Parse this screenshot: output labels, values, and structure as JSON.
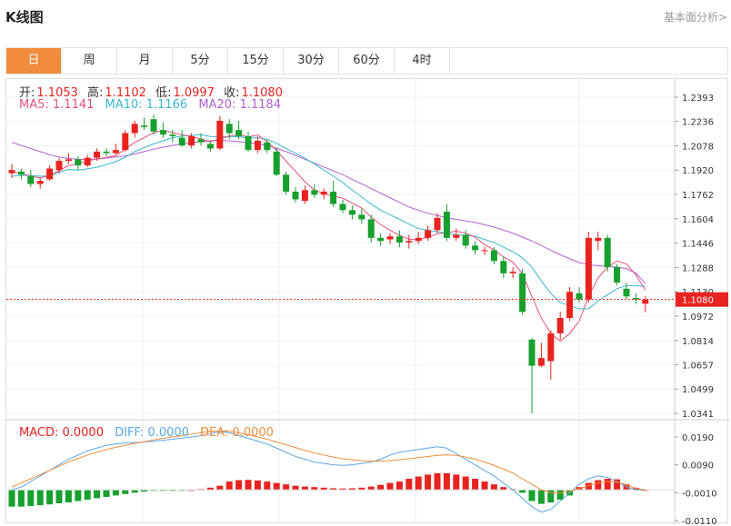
{
  "header": {
    "title": "K线图",
    "fundamental_link": "基本面分析>"
  },
  "tabs": [
    {
      "label": "日",
      "active": true
    },
    {
      "label": "周",
      "active": false
    },
    {
      "label": "月",
      "active": false
    },
    {
      "label": "5分",
      "active": false
    },
    {
      "label": "15分",
      "active": false
    },
    {
      "label": "30分",
      "active": false
    },
    {
      "label": "60分",
      "active": false
    },
    {
      "label": "4时",
      "active": false
    }
  ],
  "ohlc_info": {
    "open_label": "开:",
    "open": "1.1053",
    "high_label": "高:",
    "high": "1.1102",
    "low_label": "低:",
    "low": "1.0997",
    "close_label": "收:",
    "close": "1.1080"
  },
  "ma_info": {
    "ma5": "MA5: 1.1141",
    "ma10": "MA10: 1.1166",
    "ma20": "MA20: 1.1184"
  },
  "macd_info": {
    "macd": "MACD: 0.0000",
    "diff": "DIFF: 0.0000",
    "dea": "DEA: 0.0000"
  },
  "colors": {
    "up": "#e8231f",
    "down": "#17a02d",
    "ma5": "#e8507a",
    "ma10": "#39b7d0",
    "ma20": "#b25fd0",
    "diff": "#5aa6e6",
    "dea": "#f08c3c",
    "active_tab": "#f08c3c"
  },
  "chart_data": {
    "type": "candlestick",
    "price_axis": {
      "ticks": [
        "1.2393",
        "1.2236",
        "1.2078",
        "1.1920",
        "1.1762",
        "1.1604",
        "1.1446",
        "1.1288",
        "1.1130",
        "1.0972",
        "1.0814",
        "1.0657",
        "1.0499",
        "1.0341"
      ],
      "ylim": [
        1.0341,
        1.2393
      ],
      "last_price": "1.1080"
    },
    "macd_axis": {
      "ticks": [
        "0.0190",
        "0.0090",
        "-0.0010",
        "-0.0110"
      ],
      "ylim": [
        -0.011,
        0.019
      ]
    },
    "candles": [
      [
        1.19,
        1.196,
        1.187,
        1.192
      ],
      [
        1.191,
        1.193,
        1.186,
        1.189
      ],
      [
        1.188,
        1.192,
        1.181,
        1.183
      ],
      [
        1.183,
        1.187,
        1.18,
        1.185
      ],
      [
        1.186,
        1.195,
        1.185,
        1.193
      ],
      [
        1.192,
        1.2,
        1.19,
        1.198
      ],
      [
        1.198,
        1.203,
        1.196,
        1.199
      ],
      [
        1.199,
        1.201,
        1.192,
        1.195
      ],
      [
        1.195,
        1.202,
        1.194,
        1.2
      ],
      [
        1.2,
        1.206,
        1.198,
        1.204
      ],
      [
        1.204,
        1.206,
        1.201,
        1.203
      ],
      [
        1.203,
        1.209,
        1.202,
        1.205
      ],
      [
        1.205,
        1.218,
        1.204,
        1.216
      ],
      [
        1.216,
        1.224,
        1.213,
        1.222
      ],
      [
        1.221,
        1.226,
        1.218,
        1.22
      ],
      [
        1.225,
        1.228,
        1.215,
        1.217
      ],
      [
        1.218,
        1.223,
        1.213,
        1.215
      ],
      [
        1.215,
        1.218,
        1.21,
        1.214
      ],
      [
        1.213,
        1.218,
        1.207,
        1.208
      ],
      [
        1.208,
        1.216,
        1.206,
        1.214
      ],
      [
        1.212,
        1.216,
        1.208,
        1.21
      ],
      [
        1.209,
        1.211,
        1.204,
        1.206
      ],
      [
        1.206,
        1.227,
        1.205,
        1.224
      ],
      [
        1.222,
        1.225,
        1.212,
        1.216
      ],
      [
        1.218,
        1.224,
        1.212,
        1.214
      ],
      [
        1.214,
        1.217,
        1.204,
        1.205
      ],
      [
        1.205,
        1.214,
        1.203,
        1.211
      ],
      [
        1.21,
        1.212,
        1.203,
        1.205
      ],
      [
        1.204,
        1.207,
        1.188,
        1.189
      ],
      [
        1.189,
        1.191,
        1.176,
        1.178
      ],
      [
        1.178,
        1.181,
        1.171,
        1.173
      ],
      [
        1.172,
        1.182,
        1.17,
        1.179
      ],
      [
        1.179,
        1.183,
        1.174,
        1.176
      ],
      [
        1.176,
        1.18,
        1.173,
        1.178
      ],
      [
        1.178,
        1.185,
        1.168,
        1.17
      ],
      [
        1.17,
        1.173,
        1.164,
        1.166
      ],
      [
        1.166,
        1.169,
        1.16,
        1.163
      ],
      [
        1.163,
        1.167,
        1.157,
        1.16
      ],
      [
        1.16,
        1.163,
        1.145,
        1.148
      ],
      [
        1.148,
        1.151,
        1.143,
        1.146
      ],
      [
        1.147,
        1.151,
        1.144,
        1.149
      ],
      [
        1.149,
        1.153,
        1.142,
        1.145
      ],
      [
        1.145,
        1.15,
        1.141,
        1.146
      ],
      [
        1.146,
        1.152,
        1.144,
        1.148
      ],
      [
        1.148,
        1.156,
        1.146,
        1.153
      ],
      [
        1.153,
        1.164,
        1.151,
        1.161
      ],
      [
        1.165,
        1.17,
        1.146,
        1.148
      ],
      [
        1.148,
        1.154,
        1.146,
        1.15
      ],
      [
        1.15,
        1.153,
        1.141,
        1.143
      ],
      [
        1.143,
        1.146,
        1.137,
        1.14
      ],
      [
        1.14,
        1.142,
        1.137,
        1.14
      ],
      [
        1.14,
        1.142,
        1.131,
        1.133
      ],
      [
        1.133,
        1.136,
        1.122,
        1.125
      ],
      [
        1.125,
        1.129,
        1.122,
        1.126
      ],
      [
        1.125,
        1.128,
        1.098,
        1.1
      ],
      [
        1.082,
        1.083,
        1.034,
        1.065
      ],
      [
        1.065,
        1.08,
        1.064,
        1.07
      ],
      [
        1.068,
        1.088,
        1.056,
        1.086
      ],
      [
        1.086,
        1.1,
        1.082,
        1.096
      ],
      [
        1.096,
        1.116,
        1.094,
        1.113
      ],
      [
        1.112,
        1.116,
        1.106,
        1.108
      ],
      [
        1.108,
        1.152,
        1.106,
        1.148
      ],
      [
        1.146,
        1.152,
        1.14,
        1.148
      ],
      [
        1.148,
        1.15,
        1.126,
        1.129
      ],
      [
        1.129,
        1.131,
        1.117,
        1.119
      ],
      [
        1.115,
        1.119,
        1.108,
        1.11
      ],
      [
        1.109,
        1.112,
        1.105,
        1.108
      ],
      [
        1.1053,
        1.1102,
        1.0997,
        1.108
      ]
    ],
    "ma5": [
      1.1905,
      1.19,
      1.188,
      1.187,
      1.1884,
      1.1916,
      1.195,
      1.196,
      1.198,
      1.1992,
      1.2002,
      1.2014,
      1.2056,
      1.21,
      1.213,
      1.2162,
      1.2178,
      1.2164,
      1.2148,
      1.2138,
      1.2122,
      1.2104,
      1.2122,
      1.214,
      1.215,
      1.2136,
      1.2148,
      1.2104,
      1.2048,
      1.1978,
      1.1912,
      1.1844,
      1.179,
      1.1768,
      1.1752,
      1.1738,
      1.1706,
      1.1674,
      1.1614,
      1.1566,
      1.153,
      1.1496,
      1.147,
      1.1468,
      1.1484,
      1.1506,
      1.1514,
      1.1524,
      1.151,
      1.1484,
      1.1436,
      1.1402,
      1.1356,
      1.1322,
      1.1246,
      1.11,
      1.096,
      1.086,
      1.081,
      1.086,
      1.094,
      1.11,
      1.122,
      1.129,
      1.133,
      1.131,
      1.124,
      1.114
    ],
    "ma10": [
      1.188,
      1.1885,
      1.1885,
      1.188,
      1.1883,
      1.1905,
      1.1925,
      1.192,
      1.1928,
      1.1938,
      1.1955,
      1.1975,
      1.2003,
      1.204,
      1.2066,
      1.209,
      1.211,
      1.213,
      1.214,
      1.2145,
      1.215,
      1.2138,
      1.2135,
      1.2138,
      1.2136,
      1.213,
      1.213,
      1.212,
      1.2094,
      1.206,
      1.203,
      1.1996,
      1.196,
      1.192,
      1.188,
      1.184,
      1.179,
      1.1745,
      1.17,
      1.166,
      1.163,
      1.16,
      1.157,
      1.154,
      1.153,
      1.152,
      1.151,
      1.15,
      1.1496,
      1.149,
      1.147,
      1.145,
      1.142,
      1.139,
      1.135,
      1.129,
      1.12,
      1.112,
      1.106,
      1.104,
      1.102,
      1.102,
      1.107,
      1.111,
      1.115,
      1.117,
      1.117,
      1.1166
    ],
    "ma20": [
      1.21,
      1.208,
      1.206,
      1.204,
      1.202,
      1.2005,
      1.1995,
      1.199,
      1.199,
      1.1992,
      1.1998,
      1.2005,
      1.2012,
      1.2025,
      1.204,
      1.2055,
      1.2068,
      1.208,
      1.209,
      1.2098,
      1.2105,
      1.211,
      1.2112,
      1.211,
      1.2105,
      1.2098,
      1.209,
      1.208,
      1.206,
      1.204,
      1.2015,
      1.199,
      1.1965,
      1.194,
      1.1915,
      1.189,
      1.186,
      1.183,
      1.18,
      1.177,
      1.174,
      1.171,
      1.168,
      1.166,
      1.164,
      1.1625,
      1.161,
      1.16,
      1.159,
      1.158,
      1.1565,
      1.155,
      1.153,
      1.151,
      1.1485,
      1.146,
      1.143,
      1.14,
      1.137,
      1.1345,
      1.132,
      1.1305,
      1.13,
      1.1295,
      1.129,
      1.128,
      1.125,
      1.1184
    ],
    "macd_hist": [
      -0.006,
      -0.006,
      -0.0058,
      -0.0055,
      -0.0052,
      -0.0048,
      -0.0045,
      -0.004,
      -0.0035,
      -0.003,
      -0.0025,
      -0.002,
      -0.0015,
      -0.001,
      -0.0006,
      -0.0003,
      -0.0001,
      -0.0003,
      -0.0002,
      0.0,
      0.0003,
      0.0008,
      0.0015,
      0.003,
      0.0035,
      0.0036,
      0.0034,
      0.003,
      0.0025,
      0.002,
      0.0015,
      0.0012,
      0.001,
      0.0008,
      0.0006,
      0.0005,
      0.0006,
      0.0008,
      0.0012,
      0.0018,
      0.0025,
      0.003,
      0.004,
      0.0048,
      0.0055,
      0.006,
      0.006,
      0.0055,
      0.0048,
      0.004,
      0.003,
      0.002,
      0.001,
      0.0003,
      -0.001,
      -0.004,
      -0.005,
      -0.0045,
      -0.0035,
      -0.002,
      0.001,
      0.0025,
      0.0035,
      0.004,
      0.0038,
      0.002,
      0.0008,
      0.0
    ],
    "diff": [
      0.0,
      0.001,
      0.003,
      0.005,
      0.007,
      0.009,
      0.011,
      0.0125,
      0.014,
      0.015,
      0.016,
      0.0165,
      0.0168,
      0.017,
      0.0172,
      0.0175,
      0.0178,
      0.0182,
      0.0186,
      0.019,
      0.0195,
      0.02,
      0.021,
      0.0205,
      0.0195,
      0.0185,
      0.0175,
      0.0165,
      0.015,
      0.0135,
      0.012,
      0.011,
      0.01,
      0.0095,
      0.009,
      0.0088,
      0.009,
      0.0095,
      0.01,
      0.011,
      0.0125,
      0.0135,
      0.014,
      0.0145,
      0.015,
      0.0155,
      0.015,
      0.013,
      0.011,
      0.009,
      0.007,
      0.005,
      0.0025,
      0.0,
      -0.003,
      -0.006,
      -0.008,
      -0.007,
      -0.004,
      -0.001,
      0.002,
      0.004,
      0.005,
      0.0045,
      0.003,
      0.001,
      0.0,
      0.0
    ],
    "dea": [
      0.001,
      0.0025,
      0.004,
      0.0055,
      0.007,
      0.0085,
      0.01,
      0.0113,
      0.0125,
      0.0135,
      0.0145,
      0.0153,
      0.016,
      0.0167,
      0.0173,
      0.018,
      0.0185,
      0.019,
      0.0195,
      0.02,
      0.0205,
      0.021,
      0.0212,
      0.021,
      0.0205,
      0.0198,
      0.019,
      0.0182,
      0.0172,
      0.0162,
      0.0152,
      0.0142,
      0.0133,
      0.0125,
      0.0118,
      0.0112,
      0.0108,
      0.0105,
      0.0103,
      0.0103,
      0.0105,
      0.0108,
      0.0112,
      0.0116,
      0.012,
      0.0124,
      0.0126,
      0.0124,
      0.0118,
      0.011,
      0.01,
      0.0088,
      0.0075,
      0.006,
      0.004,
      0.002,
      0.0,
      -0.001,
      -0.001,
      -0.0005,
      0.0005,
      0.0015,
      0.0025,
      0.003,
      0.0028,
      0.0018,
      0.0005,
      0.0
    ]
  }
}
